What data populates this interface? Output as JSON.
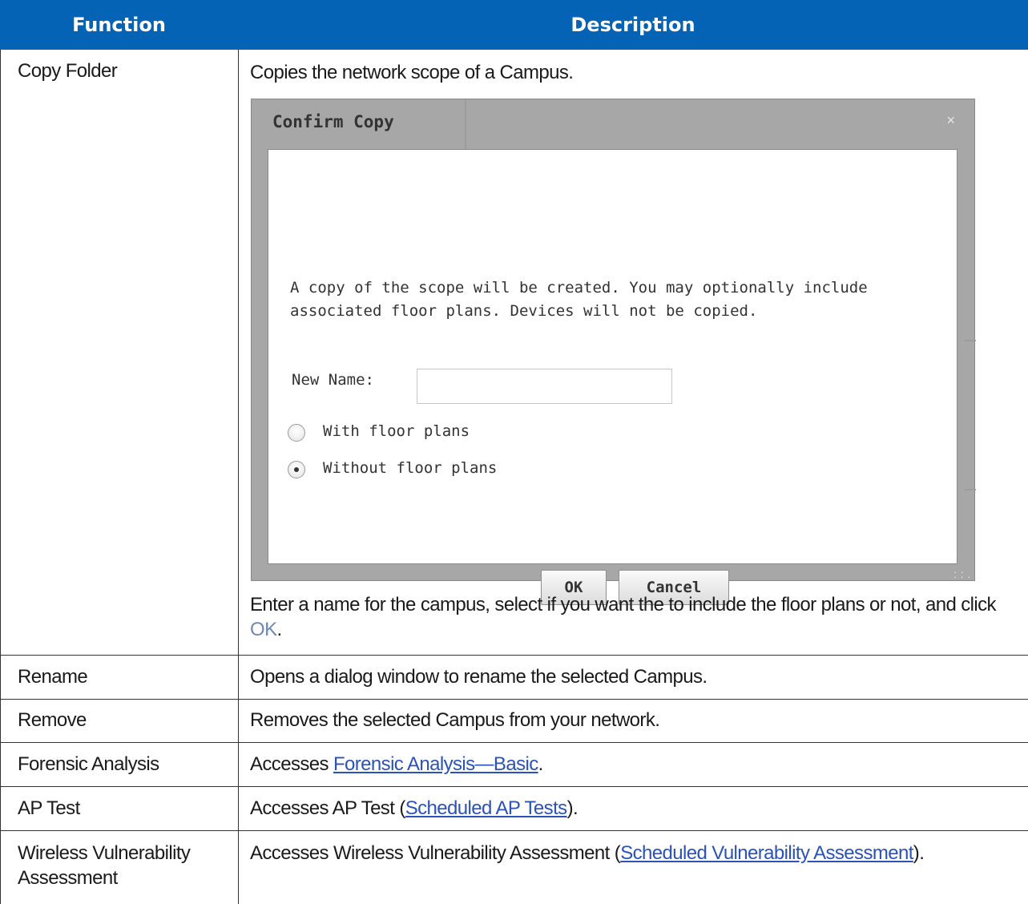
{
  "header": {
    "function_label": "Function",
    "description_label": "Description"
  },
  "rows": [
    {
      "function": "Copy Folder",
      "description": "Copies the network scope of a Campus.",
      "after_text": "Enter a name for the campus, select if you want the to include the floor plans or not, and click ",
      "after_ok": "OK",
      "after_end": "."
    },
    {
      "function": "Rename",
      "description": "Opens a dialog window to rename the selected Campus."
    },
    {
      "function": "Remove",
      "description": "Removes the selected Campus from your network."
    },
    {
      "function": "Forensic Analysis",
      "description_prefix": "Accesses ",
      "link": "Forensic Analysis—Basic",
      "description_suffix": "."
    },
    {
      "function": "AP Test",
      "description_prefix": "Accesses AP Test (",
      "link": "Scheduled AP Tests",
      "description_suffix": ")."
    },
    {
      "function_line1": "Wireless Vulnerability",
      "function_line2": "Assessment",
      "description_prefix": "Accesses Wireless Vulnerability Assessment (",
      "link": "Scheduled Vulnerability Assessment",
      "description_suffix": ")."
    }
  ],
  "dialog": {
    "title": "Confirm Copy",
    "close_icon": "×",
    "message": "A copy of the scope will be created. You may optionally include\nassociated floor plans. Devices will not be copied.",
    "new_name_label": "New Name:",
    "new_name_value": "",
    "option_with": "With floor plans",
    "option_without": "Without floor plans",
    "selected_option": "Without floor plans",
    "ok_label": "OK",
    "cancel_label": "Cancel"
  },
  "colors": {
    "header_bg": "#0563b5",
    "link": "#2b52b8"
  }
}
